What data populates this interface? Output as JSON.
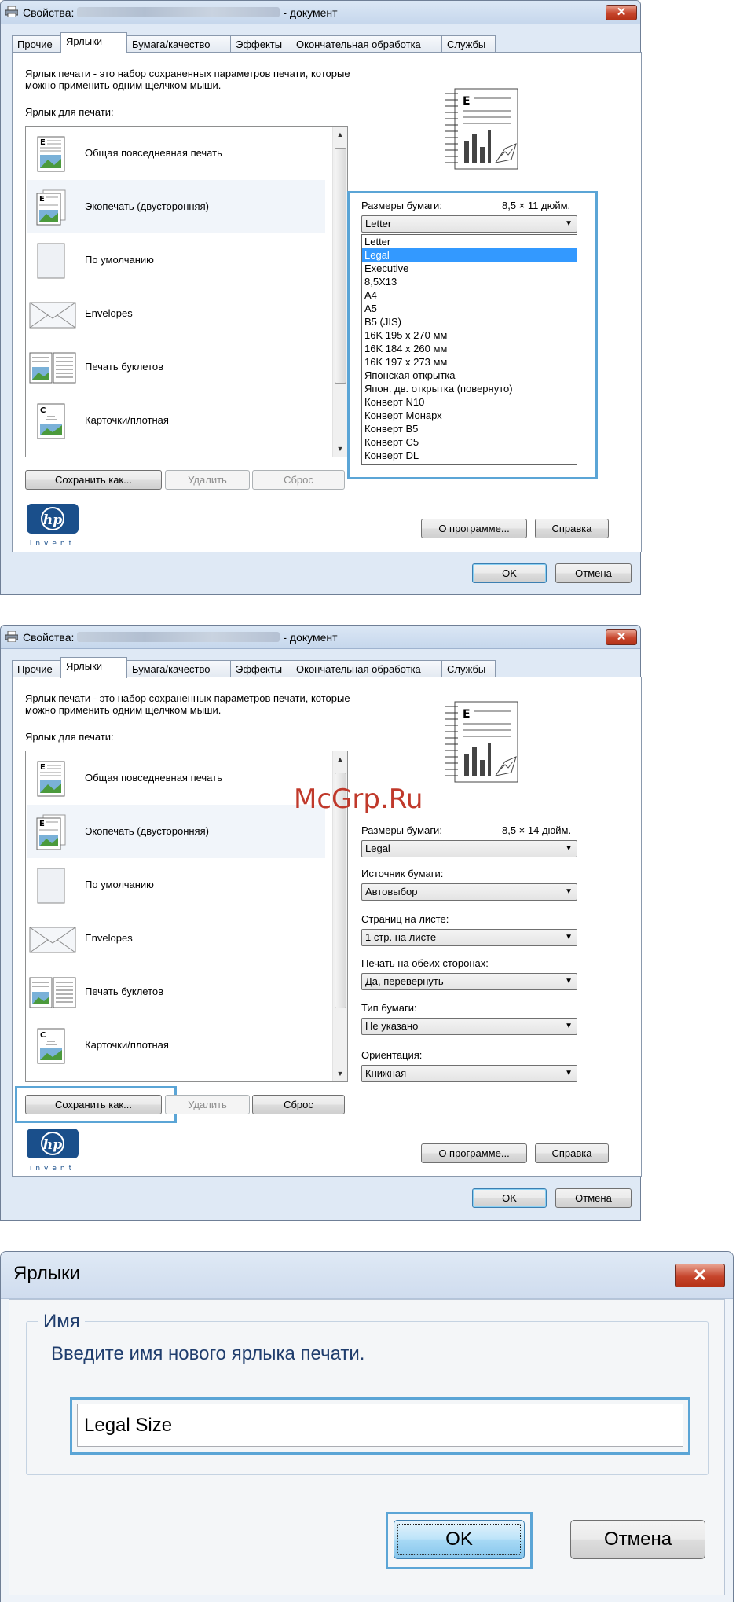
{
  "common": {
    "title_prefix": "Свойства:",
    "title_suffix": "- документ",
    "tabs": [
      "Прочие",
      "Ярлыки",
      "Бумага/качество",
      "Эффекты",
      "Окончательная обработка",
      "Службы"
    ],
    "description_line1": "Ярлык печати - это набор сохраненных параметров печати, которые",
    "description_line2": "можно применить одним щелчком мыши.",
    "shortcut_label": "Ярлык для печати:",
    "shortcuts": [
      {
        "label": "Общая повседневная печать",
        "icon": "document-e-icon"
      },
      {
        "label": "Экопечать (двусторонняя)",
        "icon": "duplex-document-icon"
      },
      {
        "label": "По умолчанию",
        "icon": "blank-page-icon"
      },
      {
        "label": "Envelopes",
        "icon": "envelope-icon"
      },
      {
        "label": "Печать буклетов",
        "icon": "booklet-icon"
      },
      {
        "label": "Карточки/плотная",
        "icon": "card-document-icon"
      }
    ],
    "save_as": "Сохранить как...",
    "delete": "Удалить",
    "reset": "Сброс",
    "about": "О программе...",
    "help": "Справка",
    "ok": "OK",
    "cancel": "Отмена",
    "paper_size_label": "Размеры бумаги:",
    "hp_logo_text": "invent",
    "close_symbol": "✕"
  },
  "window1": {
    "paper_size_dims": "8,5 × 11 дюйм.",
    "paper_size_value": "Letter",
    "dropdown_options": [
      "Letter",
      "Legal",
      "Executive",
      "8,5X13",
      "A4",
      "A5",
      "B5 (JIS)",
      "16K 195 x 270 мм",
      "16K 184 x 260 мм",
      "16K 197 x 273 мм",
      "Японская открытка",
      "Япон. дв. открытка (повернуто)",
      "Конверт N10",
      "Конверт Монарх",
      "Конверт B5",
      "Конверт C5",
      "Конверт DL"
    ],
    "dropdown_selected": "Legal"
  },
  "window2": {
    "paper_size_dims": "8,5 × 14 дюйм.",
    "watermark": "McGrp.Ru",
    "fields": [
      {
        "label": "Размеры бумаги:",
        "value": "Legal"
      },
      {
        "label": "Источник бумаги:",
        "value": "Автовыбор"
      },
      {
        "label": "Страниц на листе:",
        "value": "1 стр. на листе"
      },
      {
        "label": "Печать на обеих сторонах:",
        "value": "Да, перевернуть"
      },
      {
        "label": "Тип бумаги:",
        "value": "Не указано"
      },
      {
        "label": "Ориентация:",
        "value": "Книжная"
      }
    ]
  },
  "window3": {
    "title": "Ярлыки",
    "group_label": "Имя",
    "prompt": "Введите имя нового ярлыка печати.",
    "input_value": "Legal Size",
    "ok": "OK",
    "cancel": "Отмена",
    "close_symbol": "✕"
  }
}
